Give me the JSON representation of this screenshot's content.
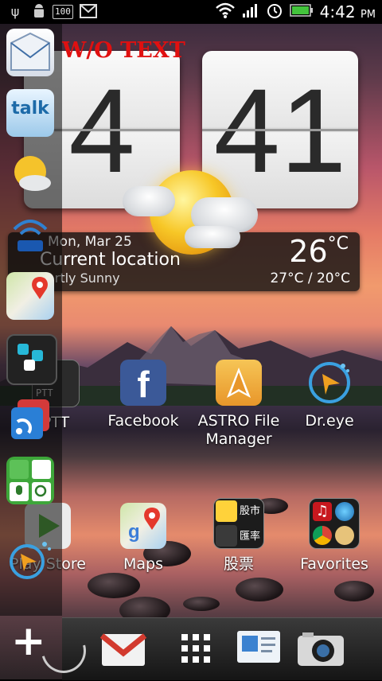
{
  "status_bar": {
    "battery_badge": "100",
    "time": "4:42",
    "ampm": "PM"
  },
  "watermark": "W/O TEXT",
  "clock_widget": {
    "hour": "4",
    "minute": "41",
    "date": "Mon, Mar 25",
    "location": "Current location",
    "condition": "Partly Sunny",
    "temperature": "26",
    "temp_unit": "°C",
    "high_low": "27°C / 20°C"
  },
  "sidebar": {
    "items": [
      {
        "name": "mail-app-icon"
      },
      {
        "name": "talk-app-icon",
        "label": "talk"
      },
      {
        "name": "weather-app-icon"
      },
      {
        "name": "wifi-router-app-icon"
      },
      {
        "name": "maps-app-icon"
      },
      {
        "name": "tunein-app-icon"
      },
      {
        "name": "rss-reader-app-icon"
      },
      {
        "name": "voice-search-app-icon"
      },
      {
        "name": "dreye-app-icon"
      }
    ]
  },
  "apps_row1": [
    {
      "label": "PTT",
      "icon": "ptt-icon"
    },
    {
      "label": "Facebook",
      "icon": "facebook-icon"
    },
    {
      "label": "ASTRO File Manager",
      "icon": "astro-folder-icon"
    },
    {
      "label": "Dr.eye",
      "icon": "dreye-icon"
    }
  ],
  "apps_row2": [
    {
      "label": "Play Store",
      "icon": "play-store-icon"
    },
    {
      "label": "Maps",
      "icon": "maps-icon"
    },
    {
      "label": "股票",
      "icon": "stocks-folder-icon",
      "tiles": [
        "股市",
        "匯率"
      ]
    },
    {
      "label": "Favorites",
      "icon": "favorites-folder-icon"
    }
  ],
  "dock": {
    "items": [
      "gmail-icon",
      "app-drawer-icon",
      "contacts-icon",
      "camera-icon"
    ]
  },
  "colors": {
    "watermark": "#e01010",
    "facebook": "#3b5998",
    "dock": "#1e1e1e"
  }
}
